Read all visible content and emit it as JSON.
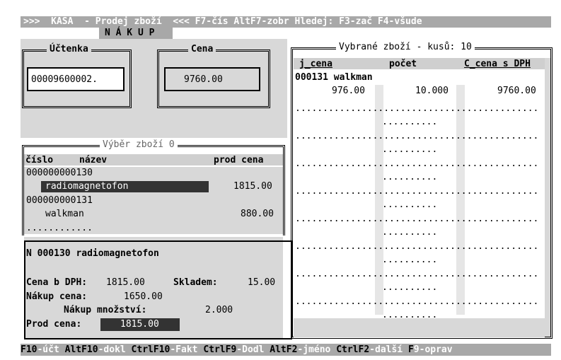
{
  "titlebar": {
    "text": ">>>  KASA  - Prodej zboží  <<< F7-čís AltF7-zobr Hledej: F3-zač F4-všude"
  },
  "nakup_tab": "N Á K U P",
  "uctenka": {
    "label": "Účtenka",
    "value": "00009600002."
  },
  "cena": {
    "label": "Cena",
    "value": "9760.00"
  },
  "vyber": {
    "label": "Výběr zboží 0",
    "headers": {
      "cislo": "číslo",
      "nazev": "název",
      "prod_cena": "prod cena"
    },
    "items": [
      {
        "code": "000000000130",
        "name": "radiomagnetofon",
        "price": "1815.00",
        "selected": true
      },
      {
        "code": "000000000131",
        "name": "walkman",
        "price": "880.00",
        "selected": false
      }
    ],
    "empty_row": "............"
  },
  "detail": {
    "title": "N 000130 radiomagnetofon",
    "cena_b_dph_label": "Cena b DPH:",
    "cena_b_dph_value": "1815.00",
    "skladem_label": "Skladem:",
    "skladem_value": "15.00",
    "nakup_cena_label": "Nákup cena:",
    "nakup_cena_value": "1650.00",
    "nakup_mnozstvi_label": "Nákup množství:",
    "nakup_mnozstvi_value": "2.000",
    "prod_cena_label": "Prod cena:",
    "prod_cena_value": "1815.00"
  },
  "vybrane": {
    "label": "Vybrané zboží - kusů: 10",
    "headers": {
      "j_cena": "j_cena",
      "pocet": "počet",
      "c_cena": "C_cena s DPH"
    },
    "items": [
      {
        "name": "000131 walkman",
        "j_cena": "976.00",
        "pocet": "10.000",
        "c_cena": "9760.00"
      }
    ],
    "dot_rows": 8
  },
  "fkeys": [
    {
      "key": "F10",
      "desc": "-účt"
    },
    {
      "key": " AltF10",
      "desc": "-dokl"
    },
    {
      "key": " CtrlF10",
      "desc": "-Fakt"
    },
    {
      "key": " CtrlF9",
      "desc": "-Dodl"
    },
    {
      "key": " AltF2",
      "desc": "-jméno"
    },
    {
      "key": " CtrlF2",
      "desc": "-další"
    },
    {
      "key": " F",
      "desc": "9-oprav"
    }
  ],
  "colors": {
    "bar_gray": "#a8a8a8",
    "panel_gray": "#d8d8d8",
    "text": "#000000",
    "bar_text": "#ffffff"
  }
}
